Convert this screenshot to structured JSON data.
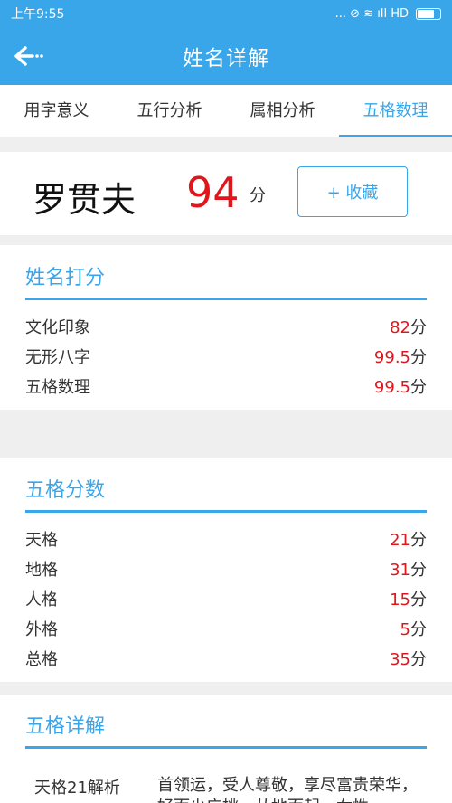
{
  "status": {
    "time": "上午9:55",
    "icons_text": "... ⊘ ≋ ıll HD"
  },
  "appbar": {
    "title": "姓名详解"
  },
  "tabs": [
    {
      "label": "用字意义"
    },
    {
      "label": "五行分析"
    },
    {
      "label": "属相分析"
    },
    {
      "label": "五格数理"
    }
  ],
  "name_card": {
    "name": "罗贯夫",
    "score": "94",
    "score_unit": "分",
    "favorite_label": "+ 收藏"
  },
  "score_section": {
    "title": "姓名打分",
    "rows": [
      {
        "label": "文化印象",
        "value": "82",
        "unit": "分"
      },
      {
        "label": "无形八字",
        "value": "99.5",
        "unit": "分"
      },
      {
        "label": "五格数理",
        "value": "99.5",
        "unit": "分"
      }
    ]
  },
  "wuge_section": {
    "title": "五格分数",
    "rows": [
      {
        "label": "天格",
        "value": "21",
        "unit": "分"
      },
      {
        "label": "地格",
        "value": "31",
        "unit": "分"
      },
      {
        "label": "人格",
        "value": "15",
        "unit": "分"
      },
      {
        "label": "外格",
        "value": "5",
        "unit": "分"
      },
      {
        "label": "总格",
        "value": "35",
        "unit": "分"
      }
    ]
  },
  "detail_section": {
    "title": "五格详解",
    "items": [
      {
        "label": "天格21解析",
        "text": "首领运，受人尊敬，享尽富贵荣华，好而少广桃，从地而起，女性"
      }
    ]
  },
  "colors": {
    "accent": "#3aa6ea",
    "score_red": "#e0161c"
  }
}
